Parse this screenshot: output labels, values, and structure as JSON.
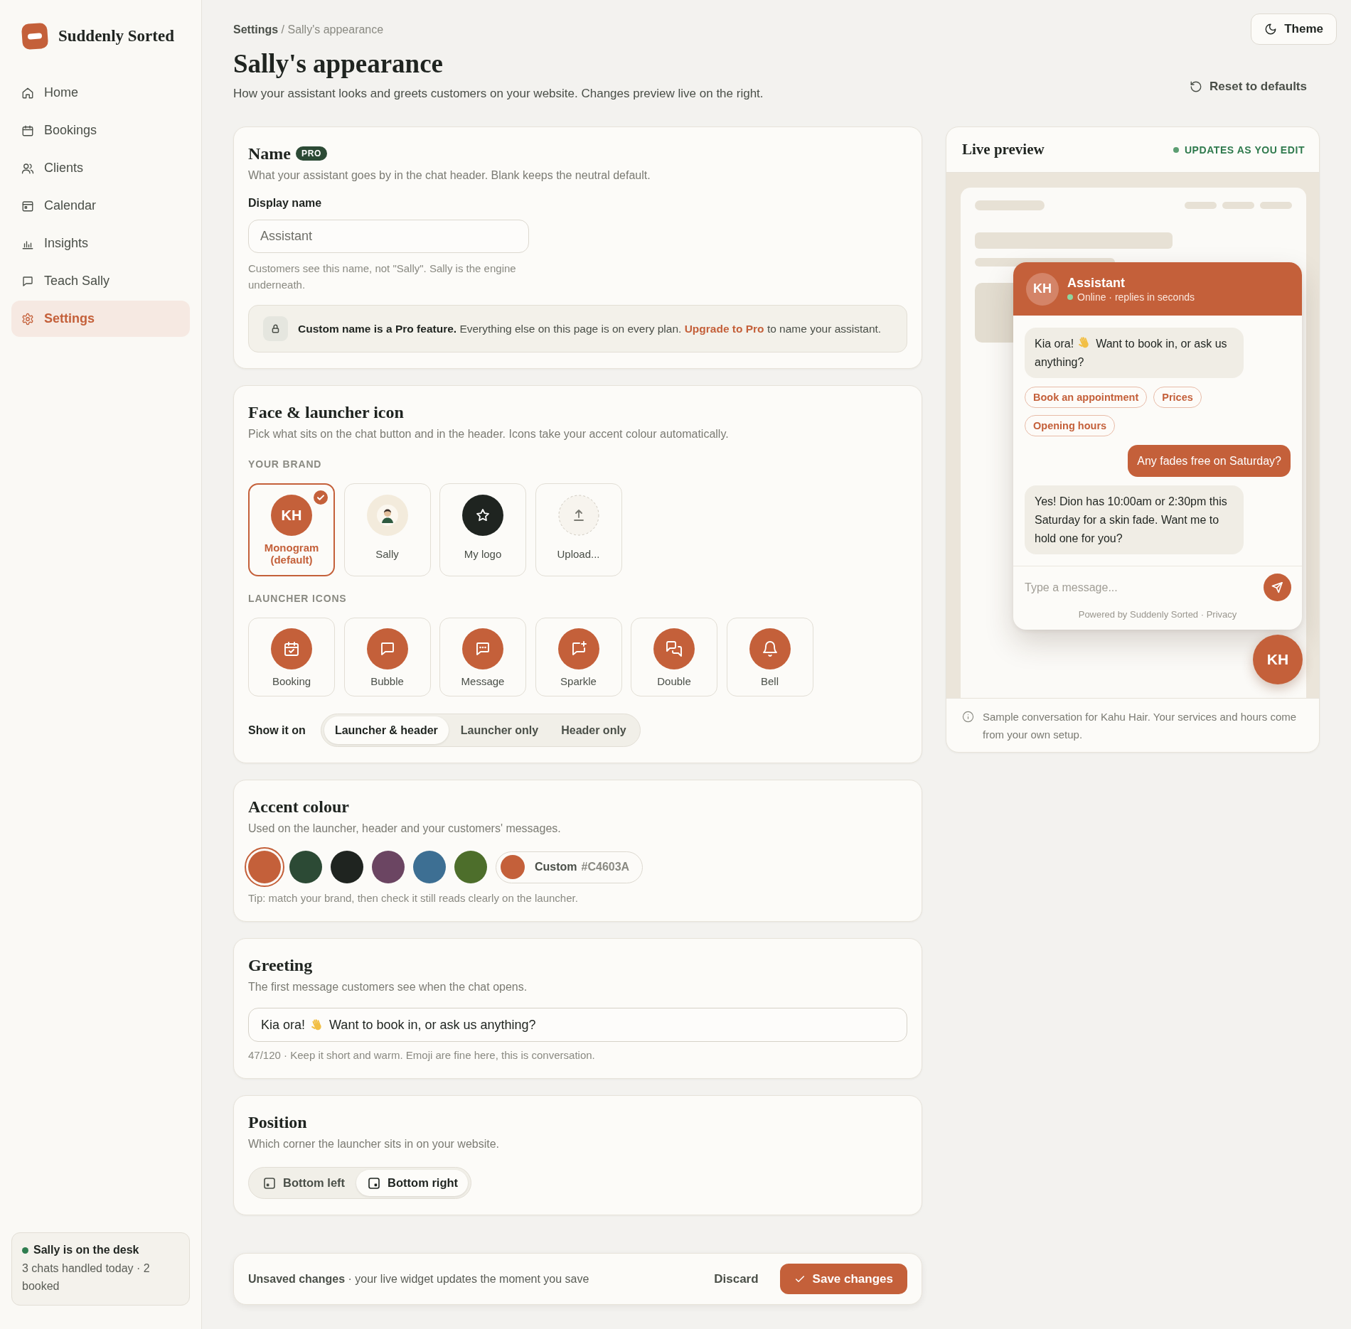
{
  "sidebar": {
    "brand": "Suddenly Sorted",
    "items": [
      {
        "label": "Home",
        "selected": false
      },
      {
        "label": "Bookings",
        "selected": false
      },
      {
        "label": "Clients",
        "selected": false
      },
      {
        "label": "Calendar",
        "selected": false
      },
      {
        "label": "Insights",
        "selected": false
      },
      {
        "label": "Teach Sally",
        "selected": false
      },
      {
        "label": "Settings",
        "selected": true
      }
    ],
    "status": {
      "title": "Sally is on the desk",
      "detail": "3 chats handled today · 2 booked",
      "online": true
    }
  },
  "header": {
    "breadcrumb": "**Settings** / Sally's appearance",
    "title": "Sally's appearance",
    "subtitle": "How your assistant looks and greets customers on your website. Changes preview live on the right.",
    "theme_button": "Theme",
    "reset_button": "Reset to defaults"
  },
  "name_card": {
    "title": "Name",
    "badge": "PRO",
    "description": "What your assistant goes by in the chat header. Blank keeps the neutral default.",
    "field_label": "Display name",
    "placeholder": "Assistant",
    "hint": "Customers see this name, not \"Sally\". Sally is the engine underneath.",
    "notice": {
      "text": "**Custom name is a Pro feature.** Everything else on this page is on every plan.",
      "link": "Upgrade to Pro",
      "text_after": "to name your assistant."
    }
  },
  "face_card": {
    "title": "Face & launcher icon",
    "description": "Pick what sits on the chat button and in the header. Icons take your accent colour automatically.",
    "brand_heading": "YOUR BRAND",
    "brand_options": [
      {
        "kind": "monogram",
        "label": "Monogram (default)",
        "monogram": "KH",
        "selected": true
      },
      {
        "kind": "avatar",
        "label": "Sally",
        "selected": false
      },
      {
        "kind": "logo",
        "label": "My logo",
        "selected": false
      },
      {
        "kind": "upload",
        "label": "Upload...",
        "selected": false
      }
    ],
    "launcher_heading": "LAUNCHER ICONS",
    "launcher_icons": [
      {
        "label": "Booking",
        "selected": false
      },
      {
        "label": "Bubble",
        "selected": false
      },
      {
        "label": "Message",
        "selected": false
      },
      {
        "label": "Sparkle",
        "selected": false
      },
      {
        "label": "Double",
        "selected": false
      },
      {
        "label": "Bell",
        "selected": false
      }
    ],
    "show_on": {
      "label": "Show it on",
      "options": [
        {
          "label": "Launcher & header",
          "selected": true
        },
        {
          "label": "Launcher only",
          "selected": false
        },
        {
          "label": "Header only",
          "selected": false
        }
      ]
    }
  },
  "accent": {
    "title": "Accent colour",
    "description": "Used on the launcher, header and your customers' messages.",
    "swatches": [
      {
        "color": "#c4603a",
        "selected": true
      },
      {
        "color": "#2c4a35",
        "selected": false
      },
      {
        "color": "#1f2420",
        "selected": false
      },
      {
        "color": "#6b4562",
        "selected": false
      },
      {
        "color": "#3d6f93",
        "selected": false
      },
      {
        "color": "#4d6e2b",
        "selected": false
      }
    ],
    "custom": {
      "label": "Custom",
      "value": "#C4603A",
      "color": "#c4603a"
    },
    "tip": "Tip: match your brand, then check it still reads clearly on the launcher."
  },
  "greeting": {
    "title": "Greeting",
    "description": "The first message customers see when the chat opens.",
    "value_parts": [
      "Kia ora!",
      "Want to book in, or ask us anything?"
    ],
    "hint": "47/120 · Keep it short and warm. Emoji are fine here, this is conversation."
  },
  "position": {
    "title": "Position",
    "description": "Which corner the launcher sits in on your website.",
    "options": [
      {
        "label": "Bottom left",
        "selected": false
      },
      {
        "label": "Bottom right",
        "selected": true
      }
    ]
  },
  "save_bar": {
    "message": "**Unsaved changes** · your live widget updates the moment you save",
    "discard": "Discard",
    "save": "Save changes"
  },
  "preview": {
    "title": "Live preview",
    "status": "UPDATES AS YOU EDIT",
    "chat": {
      "avatar": "KH",
      "name": "Assistant",
      "status": "Online · replies in seconds",
      "online": true,
      "messages": [
        {
          "kind": "bot",
          "parts": [
            "Kia ora!",
            "Want to book in, or ask us anything?"
          ]
        },
        {
          "kind": "chips",
          "chips": [
            "Book an appointment",
            "Prices",
            "Opening hours"
          ]
        },
        {
          "kind": "user",
          "parts": [
            "Any fades free on Saturday?"
          ]
        },
        {
          "kind": "bot",
          "parts": [
            "Yes! Dion has 10:00am or 2:30pm this Saturday for a skin fade. Want me to hold one for you?"
          ]
        }
      ],
      "placeholder": "Type a message...",
      "footer": "Powered by Suddenly Sorted · Privacy",
      "launcher": "KH"
    },
    "note": "Sample conversation for Kahu Hair. Your services and hours come from your own setup."
  }
}
